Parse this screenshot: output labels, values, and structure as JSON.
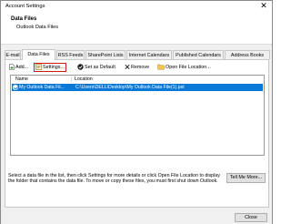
{
  "window": {
    "title": "Account Settings",
    "close_glyph": "✕"
  },
  "header": {
    "title": "Data Files",
    "subtitle": "Outlook Data Files"
  },
  "tabs": [
    {
      "label": "E-mail"
    },
    {
      "label": "Data Files",
      "active": true
    },
    {
      "label": "RSS Feeds"
    },
    {
      "label": "SharePoint Lists"
    },
    {
      "label": "Internet Calendars"
    },
    {
      "label": "Published Calendars"
    },
    {
      "label": "Address Books"
    }
  ],
  "toolbar": {
    "add": "Add...",
    "settings": "Settings...",
    "set_default": "Set as Default",
    "remove": "Remove",
    "open_location": "Open File Location...",
    "highlight_color": "#d01818"
  },
  "list": {
    "columns": [
      "Name",
      "Location"
    ],
    "rows": [
      {
        "name": "My Outlook Data Fil...",
        "location": "C:\\Users\\DELL\\Desktop\\My Outlook Data File(1).pst",
        "selected": true
      }
    ],
    "selection_color": "#0a78d7"
  },
  "description": "Select a data file in the list, then click Settings for more details or click Open File Location to display the folder that contains the data file. To move or copy these files, you must first shut down Outlook.",
  "tell_me_more": "Tell Me More...",
  "close": "Close"
}
